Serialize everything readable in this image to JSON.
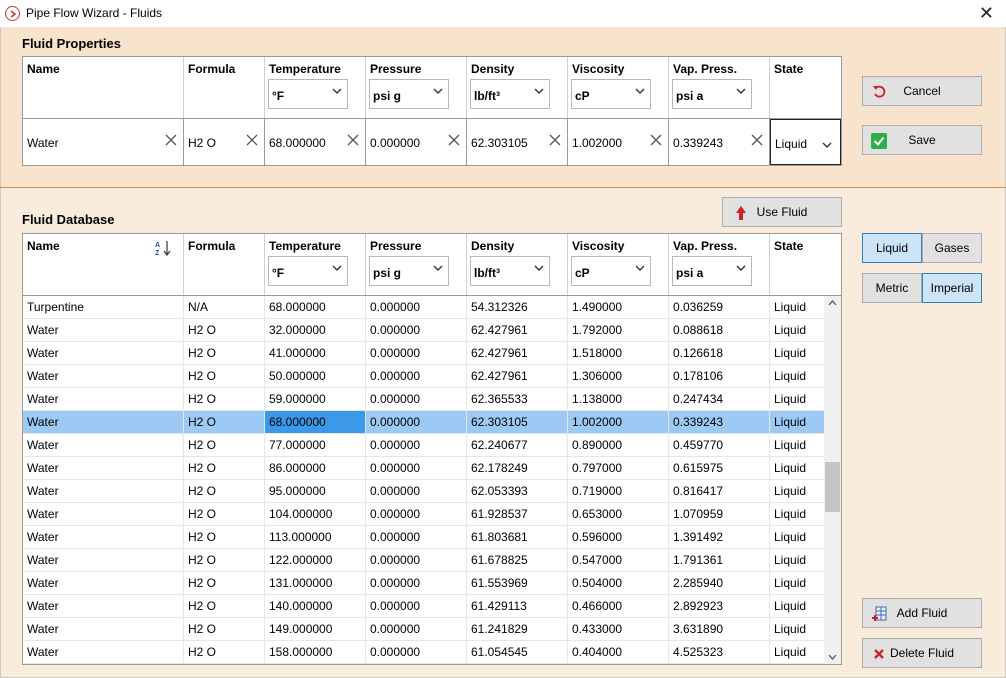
{
  "window": {
    "title": "Pipe Flow Wizard - Fluids"
  },
  "props": {
    "title": "Fluid Properties",
    "headers": [
      "Name",
      "Formula",
      "Temperature",
      "Pressure",
      "Density",
      "Viscosity",
      "Vap. Press.",
      "State"
    ],
    "units": [
      "°F",
      "psi g",
      "lb/ft³",
      "cP",
      "psi a"
    ],
    "values": [
      "Water",
      "H2 O",
      "68.000000",
      "0.000000",
      "62.303105",
      "1.002000",
      "0.339243"
    ],
    "state": "Liquid"
  },
  "buttons": {
    "cancel": "Cancel",
    "save": "Save",
    "use_fluid": "Use Fluid",
    "add_fluid": "Add Fluid",
    "delete_fluid": "Delete Fluid"
  },
  "toggles": {
    "liquid": "Liquid",
    "gases": "Gases",
    "metric": "Metric",
    "imperial": "Imperial",
    "active_phase": "Liquid",
    "active_units": "Imperial"
  },
  "db": {
    "title": "Fluid Database",
    "headers": [
      "Name",
      "Formula",
      "Temperature",
      "Pressure",
      "Density",
      "Viscosity",
      "Vap. Press.",
      "State"
    ],
    "units": [
      "°F",
      "psi g",
      "lb/ft³",
      "cP",
      "psi a"
    ],
    "selected_index": 5,
    "rows": [
      [
        "Turpentine",
        "N/A",
        "68.000000",
        "0.000000",
        "54.312326",
        "1.490000",
        "0.036259",
        "Liquid"
      ],
      [
        "Water",
        "H2 O",
        "32.000000",
        "0.000000",
        "62.427961",
        "1.792000",
        "0.088618",
        "Liquid"
      ],
      [
        "Water",
        "H2 O",
        "41.000000",
        "0.000000",
        "62.427961",
        "1.518000",
        "0.126618",
        "Liquid"
      ],
      [
        "Water",
        "H2 O",
        "50.000000",
        "0.000000",
        "62.427961",
        "1.306000",
        "0.178106",
        "Liquid"
      ],
      [
        "Water",
        "H2 O",
        "59.000000",
        "0.000000",
        "62.365533",
        "1.138000",
        "0.247434",
        "Liquid"
      ],
      [
        "Water",
        "H2 O",
        "68.000000",
        "0.000000",
        "62.303105",
        "1.002000",
        "0.339243",
        "Liquid"
      ],
      [
        "Water",
        "H2 O",
        "77.000000",
        "0.000000",
        "62.240677",
        "0.890000",
        "0.459770",
        "Liquid"
      ],
      [
        "Water",
        "H2 O",
        "86.000000",
        "0.000000",
        "62.178249",
        "0.797000",
        "0.615975",
        "Liquid"
      ],
      [
        "Water",
        "H2 O",
        "95.000000",
        "0.000000",
        "62.053393",
        "0.719000",
        "0.816417",
        "Liquid"
      ],
      [
        "Water",
        "H2 O",
        "104.000000",
        "0.000000",
        "61.928537",
        "0.653000",
        "1.070959",
        "Liquid"
      ],
      [
        "Water",
        "H2 O",
        "113.000000",
        "0.000000",
        "61.803681",
        "0.596000",
        "1.391492",
        "Liquid"
      ],
      [
        "Water",
        "H2 O",
        "122.000000",
        "0.000000",
        "61.678825",
        "0.547000",
        "1.791361",
        "Liquid"
      ],
      [
        "Water",
        "H2 O",
        "131.000000",
        "0.000000",
        "61.553969",
        "0.504000",
        "2.285940",
        "Liquid"
      ],
      [
        "Water",
        "H2 O",
        "140.000000",
        "0.000000",
        "61.429113",
        "0.466000",
        "2.892923",
        "Liquid"
      ],
      [
        "Water",
        "H2 O",
        "149.000000",
        "0.000000",
        "61.241829",
        "0.433000",
        "3.631890",
        "Liquid"
      ],
      [
        "Water",
        "H2 O",
        "158.000000",
        "0.000000",
        "61.054545",
        "0.404000",
        "4.525323",
        "Liquid"
      ]
    ]
  },
  "colors": {
    "top_panel": "#f8e3cc",
    "bottom_panel": "#faecdc",
    "selection": "#9dcaf5",
    "focus_cell": "#3c98e8",
    "divider": "#d48a52"
  }
}
